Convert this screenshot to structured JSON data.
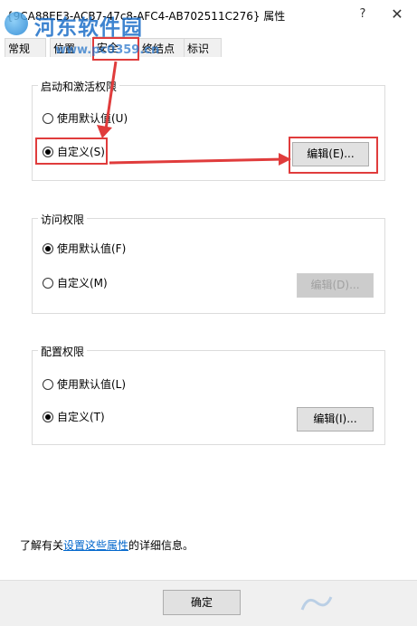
{
  "window": {
    "title": "{9CA88EE3-ACB7-47c8-AFC4-AB702511C276} 属性",
    "help_glyph": "?",
    "close_glyph": "✕"
  },
  "watermark": {
    "text": "河东软件园",
    "url": "www.pc0359.cn"
  },
  "tabs": [
    {
      "label": "常规",
      "active": false
    },
    {
      "label": "位置",
      "active": false
    },
    {
      "label": "安全",
      "active": true
    },
    {
      "label": "终结点",
      "active": false
    },
    {
      "label": "标识",
      "active": false
    }
  ],
  "groups": {
    "launch": {
      "legend": "启动和激活权限",
      "default_label": "使用默认值(U)",
      "default_checked": false,
      "custom_label": "自定义(S)",
      "custom_checked": true,
      "edit_label": "编辑(E)...",
      "edit_enabled": true
    },
    "access": {
      "legend": "访问权限",
      "default_label": "使用默认值(F)",
      "default_checked": true,
      "custom_label": "自定义(M)",
      "custom_checked": false,
      "edit_label": "编辑(D)...",
      "edit_enabled": false
    },
    "config": {
      "legend": "配置权限",
      "default_label": "使用默认值(L)",
      "default_checked": false,
      "custom_label": "自定义(T)",
      "custom_checked": true,
      "edit_label": "编辑(I)...",
      "edit_enabled": true
    }
  },
  "footer": {
    "prefix": "了解有关",
    "link": "设置这些属性",
    "suffix": "的详细信息。"
  },
  "buttons": {
    "ok": "确定"
  },
  "colors": {
    "annotation": "#e03c3c",
    "link": "#0066cc",
    "watermark": "#1d6fc8"
  }
}
